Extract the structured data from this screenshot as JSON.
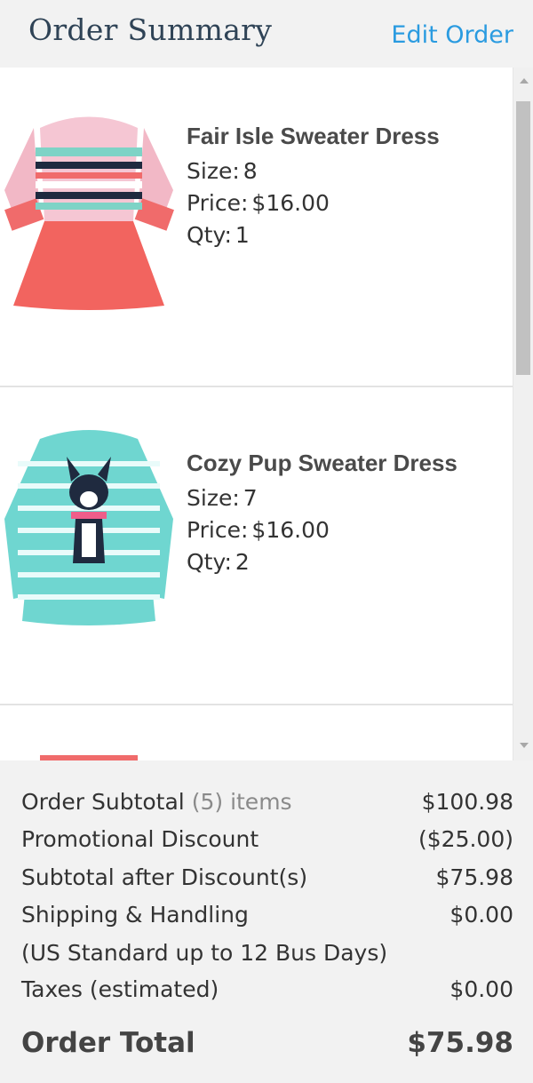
{
  "header": {
    "title": "Order Summary",
    "edit_label": "Edit Order"
  },
  "items": [
    {
      "name": "Fair Isle Sweater Dress",
      "size_label": "Size:",
      "size": "8",
      "price_label": "Price:",
      "price": "$16.00",
      "qty_label": "Qty:",
      "qty": "1"
    },
    {
      "name": "Cozy Pup Sweater Dress",
      "size_label": "Size:",
      "size": "7",
      "price_label": "Price:",
      "price": "$16.00",
      "qty_label": "Qty:",
      "qty": "2"
    }
  ],
  "summary": {
    "subtotal_label": "Order Subtotal",
    "subtotal_count": "(5) items",
    "subtotal_value": "$100.98",
    "discount_label": "Promotional Discount",
    "discount_value": "($25.00)",
    "after_discount_label": "Subtotal after Discount(s)",
    "after_discount_value": "$75.98",
    "shipping_label": "Shipping & Handling",
    "shipping_value": "$0.00",
    "shipping_note": "(US Standard up to 12 Bus Days)",
    "taxes_label": "Taxes (estimated)",
    "taxes_value": "$0.00",
    "total_label": "Order Total",
    "total_value": "$75.98"
  },
  "colors": {
    "link": "#2a9be0",
    "title": "#2f4356"
  }
}
